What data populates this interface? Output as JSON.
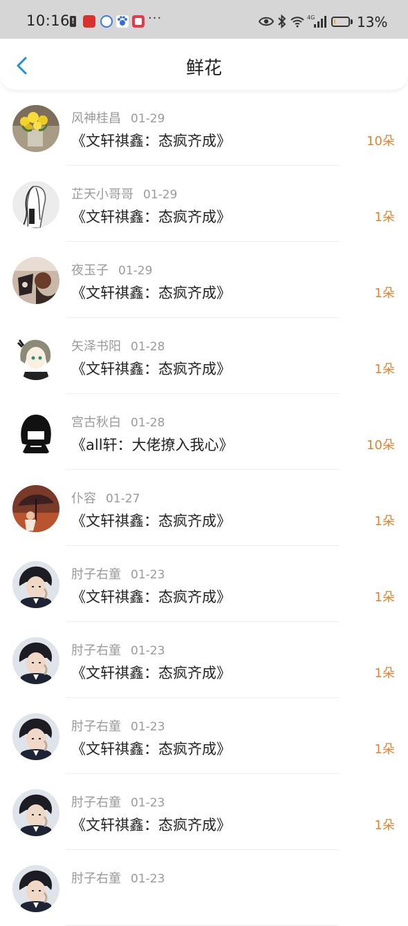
{
  "status_bar": {
    "time": "10:16",
    "dots": "···",
    "battery_percent": "13%",
    "battery_level": 0.13,
    "network_label": "4G"
  },
  "header": {
    "title": "鲜花"
  },
  "items": [
    {
      "user": "风神桂昌",
      "date": "01-29",
      "book": "《文轩祺鑫：态疯齐成》",
      "count": "10朵",
      "avatar": "flowers-avatar"
    },
    {
      "user": "芷天小哥哥",
      "date": "01-29",
      "book": "《文轩祺鑫：态疯齐成》",
      "count": "1朵",
      "avatar": "sketch-avatar"
    },
    {
      "user": "夜玉子",
      "date": "01-29",
      "book": "《文轩祺鑫：态疯齐成》",
      "count": "1朵",
      "avatar": "dark-figure-avatar"
    },
    {
      "user": "矢泽书阳",
      "date": "01-28",
      "book": "《文轩祺鑫：态疯齐成》",
      "count": "1朵",
      "avatar": "anime-girl-avatar"
    },
    {
      "user": "宫古秋白",
      "date": "01-28",
      "book": "《all轩：大佬撩入我心》",
      "count": "10朵",
      "avatar": "black-hair-avatar"
    },
    {
      "user": "仆容",
      "date": "01-27",
      "book": "《文轩祺鑫：态疯齐成》",
      "count": "1朵",
      "avatar": "umbrella-avatar"
    },
    {
      "user": "肘子右童",
      "date": "01-23",
      "book": "《文轩祺鑫：态疯齐成》",
      "count": "1朵",
      "avatar": "boy-photo-avatar"
    },
    {
      "user": "肘子右童",
      "date": "01-23",
      "book": "《文轩祺鑫：态疯齐成》",
      "count": "1朵",
      "avatar": "boy-photo-avatar"
    },
    {
      "user": "肘子右童",
      "date": "01-23",
      "book": "《文轩祺鑫：态疯齐成》",
      "count": "1朵",
      "avatar": "boy-photo-avatar"
    },
    {
      "user": "肘子右童",
      "date": "01-23",
      "book": "《文轩祺鑫：态疯齐成》",
      "count": "1朵",
      "avatar": "boy-photo-avatar"
    },
    {
      "user": "肘子右童",
      "date": "01-23",
      "book": "",
      "count": "",
      "avatar": "boy-photo-avatar"
    }
  ],
  "colors": {
    "accent": "#1f8fe0",
    "count": "#e0832f",
    "meta": "#9a9a9a",
    "text": "#222222",
    "status_bar_bg": "#d6d6d6"
  }
}
